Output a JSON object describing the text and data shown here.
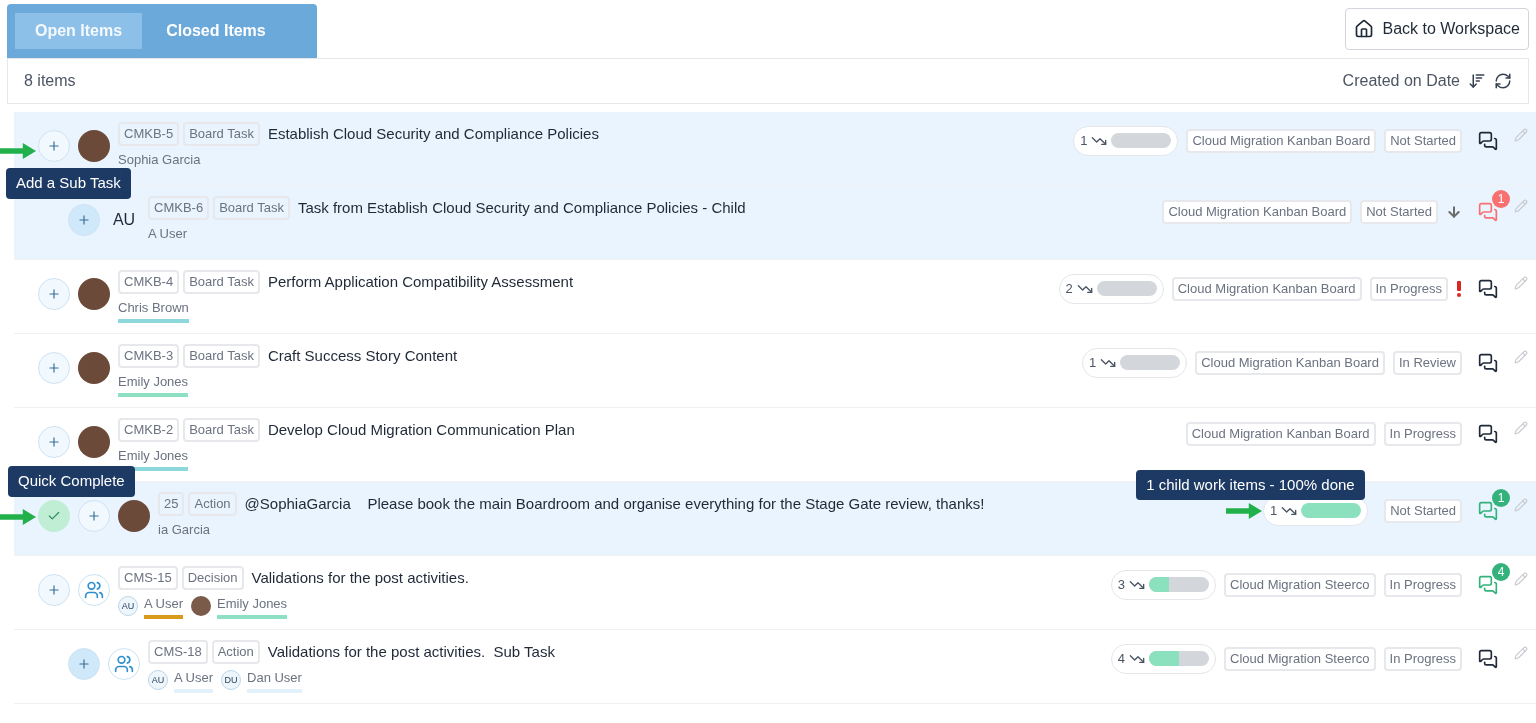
{
  "tabs": [
    {
      "label": "Open Items",
      "selected": true
    },
    {
      "label": "Closed Items",
      "selected": false
    }
  ],
  "back_button": "Back to Workspace",
  "toolbar": {
    "count": "8 items",
    "sort_label": "Created on Date"
  },
  "rows": [
    {
      "id": "CMKB-5",
      "type": "Board Task",
      "title": "Establish Cloud Security and Compliance Policies",
      "selected": true,
      "quick_complete": false,
      "avatar": {
        "kind": "photo"
      },
      "people": [
        {
          "name": "Sophia Garcia"
        }
      ],
      "progress": {
        "count": "1",
        "level": 0
      },
      "board": "Cloud Migration Kanban Board",
      "status": "Not Started",
      "comments": {
        "color": "#1f2937"
      },
      "add_tooltip": "Add a Sub Task",
      "priority_high": false,
      "moved_down": false,
      "children": [
        {
          "id": "CMKB-6",
          "type": "Board Task",
          "title": "Task from Establish Cloud Security and Compliance Policies - Child",
          "selected": true,
          "quick_complete": false,
          "avatar": {
            "kind": "initials",
            "text": "AU"
          },
          "people": [
            {
              "name": "A User"
            }
          ],
          "board": "Cloud Migration Kanban Board",
          "status": "Not Started",
          "priority_high": false,
          "moved_down": true,
          "comments": {
            "count": "1",
            "color": "#f87171"
          }
        }
      ]
    },
    {
      "id": "CMKB-4",
      "type": "Board Task",
      "title": "Perform Application Compatibility Assessment",
      "selected": false,
      "quick_complete": false,
      "avatar": {
        "kind": "photo"
      },
      "people": [
        {
          "name": "Chris Brown",
          "color": "#8dd8dc"
        }
      ],
      "progress": {
        "count": "2",
        "level": 0
      },
      "board": "Cloud Migration Kanban Board",
      "status": "In Progress",
      "priority_high": true,
      "moved_down": false,
      "comments": {
        "color": "#1f2937"
      }
    },
    {
      "id": "CMKB-3",
      "type": "Board Task",
      "title": "Craft Success Story Content",
      "selected": false,
      "quick_complete": false,
      "avatar": {
        "kind": "photo"
      },
      "people": [
        {
          "name": "Emily Jones",
          "color": "#8ee0c2"
        }
      ],
      "progress": {
        "count": "1",
        "level": 0
      },
      "board": "Cloud Migration Kanban Board",
      "status": "In Review",
      "priority_high": false,
      "moved_down": false,
      "comments": {
        "color": "#1f2937"
      }
    },
    {
      "id": "CMKB-2",
      "type": "Board Task",
      "title": "Develop Cloud Migration Communication Plan",
      "selected": false,
      "quick_complete": false,
      "avatar": {
        "kind": "photo"
      },
      "people": [
        {
          "name": "Emily Jones",
          "color": "#8dd8dc"
        }
      ],
      "board": "Cloud Migration Kanban Board",
      "status": "In Progress",
      "priority_high": false,
      "moved_down": false,
      "comments": {
        "color": "#1f2937"
      }
    },
    {
      "id": "25",
      "type": "Action",
      "title": "@SophiaGarcia    Please book the main Boardroom and organise everything for the Stage Gate review, thanks!",
      "selected": true,
      "quick_complete": true,
      "avatar": {
        "kind": "photo"
      },
      "people": [
        {
          "name": "ia Garcia"
        }
      ],
      "progress": {
        "count": "1",
        "level": 1
      },
      "status": "Not Started",
      "priority_high": false,
      "moved_down": false,
      "comments": {
        "count": "1",
        "color": "#34b27b"
      },
      "complete_tooltip": "Quick Complete",
      "progress_tooltip": "1 child work items - 100% done"
    },
    {
      "id": "CMS-15",
      "type": "Decision",
      "title": "Validations for the post activities.",
      "selected": false,
      "quick_complete": false,
      "avatar": {
        "kind": "group"
      },
      "people": [
        {
          "name": "A User",
          "badge": "AU",
          "color": "#d99a1a"
        },
        {
          "name": "Emily Jones",
          "photo": true,
          "color": "#8ee0c2"
        }
      ],
      "progress": {
        "count": "3",
        "level": 0.33
      },
      "board": "Cloud Migration Steerco",
      "status": "In Progress",
      "priority_high": false,
      "moved_down": false,
      "comments": {
        "count": "4",
        "color": "#34b27b"
      },
      "children": [
        {
          "id": "CMS-18",
          "type": "Action",
          "title": "Validations for the post activities.  Sub Task",
          "selected": false,
          "quick_complete": false,
          "avatar": {
            "kind": "group"
          },
          "people": [
            {
              "name": "A User",
              "badge": "AU",
              "color": "#e3f1fb"
            },
            {
              "name": "Dan User",
              "badge": "DU",
              "color": "#e3f1fb"
            }
          ],
          "progress": {
            "count": "4",
            "level": 0.5
          },
          "board": "Cloud Migration Steerco",
          "status": "In Progress",
          "priority_high": false,
          "moved_down": false,
          "comments": {
            "color": "#1f2937"
          }
        }
      ]
    }
  ]
}
